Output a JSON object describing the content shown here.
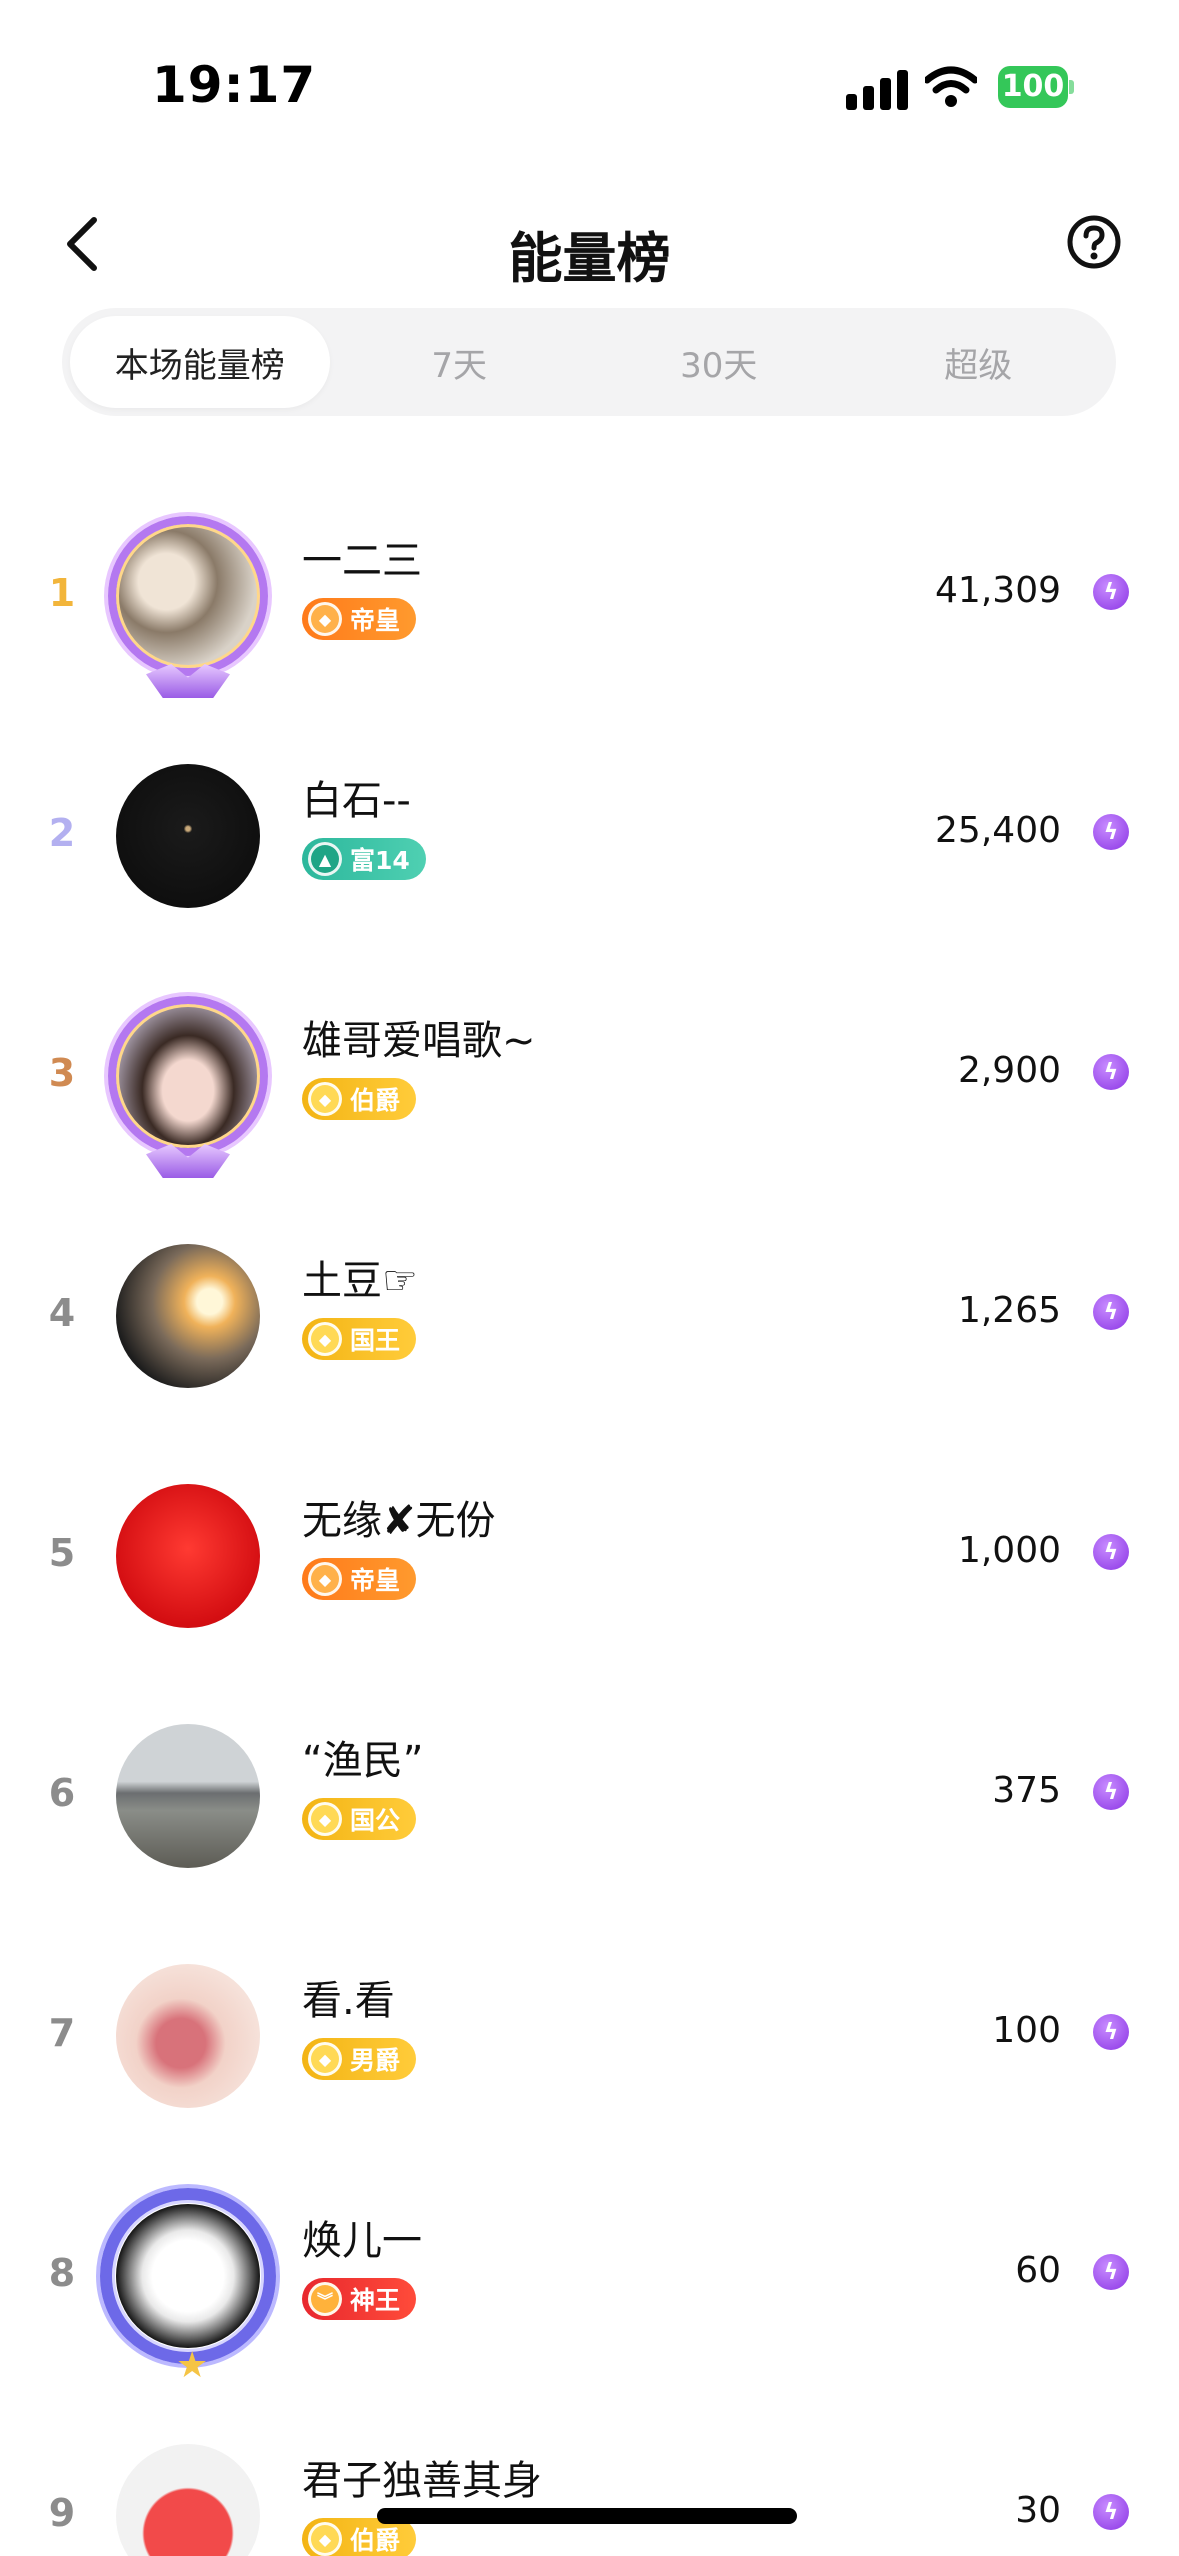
{
  "status_bar": {
    "time": "19:17",
    "battery": "100"
  },
  "header": {
    "title": "能量榜"
  },
  "tabs": [
    {
      "label": "本场能量榜",
      "active": true
    },
    {
      "label": "7天",
      "active": false
    },
    {
      "label": "30天",
      "active": false
    },
    {
      "label": "超级",
      "active": false
    }
  ],
  "ranking": [
    {
      "rank": "1",
      "name": "一二三",
      "badge": "帝皇",
      "score": "41,309",
      "rank_color": "#f2b53b"
    },
    {
      "rank": "2",
      "name": "白石--",
      "badge": "富14",
      "score": "25,400",
      "rank_color": "#b3b0f0"
    },
    {
      "rank": "3",
      "name": "雄哥爱唱歌~",
      "badge": "伯爵",
      "score": "2,900",
      "rank_color": "#d08a52"
    },
    {
      "rank": "4",
      "name": "土豆☞",
      "badge": "国王",
      "score": "1,265",
      "rank_color": "#8c8c8c"
    },
    {
      "rank": "5",
      "name": "无缘✘无份",
      "badge": "帝皇",
      "score": "1,000",
      "rank_color": "#8c8c8c"
    },
    {
      "rank": "6",
      "name": "“渔民”",
      "badge": "国公",
      "score": "375",
      "rank_color": "#8c8c8c"
    },
    {
      "rank": "7",
      "name": "看.看",
      "badge": "男爵",
      "score": "100",
      "rank_color": "#8c8c8c"
    },
    {
      "rank": "8",
      "name": "焕儿一",
      "badge": "神王",
      "score": "60",
      "rank_color": "#8c8c8c"
    },
    {
      "rank": "9",
      "name": "君子独善其身",
      "badge": "伯爵",
      "score": "30",
      "rank_color": "#8c8c8c"
    }
  ]
}
